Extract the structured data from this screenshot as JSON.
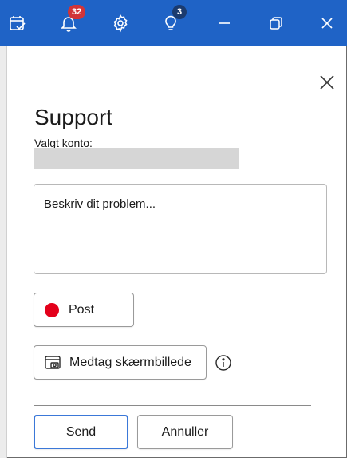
{
  "titlebar": {
    "notifications_count": "32",
    "tips_count": "3",
    "icons": [
      "tasks-icon",
      "bell-icon",
      "gear-icon",
      "lightbulb-icon",
      "minimize-icon",
      "restore-icon",
      "close-icon"
    ]
  },
  "pane": {
    "title": "Support",
    "account_label": "Valgt konto:",
    "account_value": "",
    "description_placeholder": "Beskriv dit problem...",
    "category_label": "Post",
    "category_color": "#e3001b",
    "screenshot_label": "Medtag skærmbillede",
    "send_label": "Send",
    "cancel_label": "Annuller"
  },
  "colors": {
    "titlebar": "#1f63c6",
    "badge_red": "#d13438",
    "badge_dark": "#1b3b6f",
    "send_border": "#3b78d8"
  }
}
